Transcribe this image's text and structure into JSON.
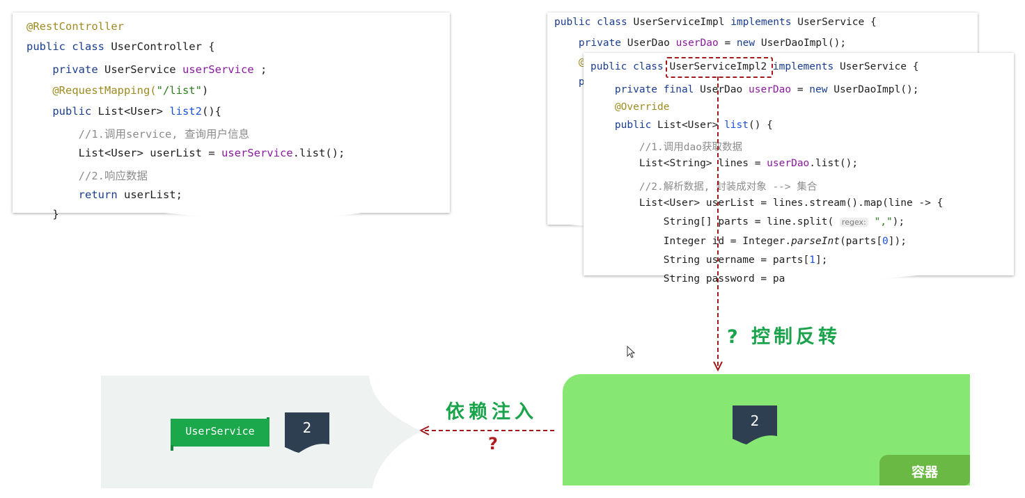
{
  "controller_code": {
    "lines": [
      [
        {
          "t": "@RestController",
          "c": "an"
        }
      ],
      [
        {
          "t": "public class ",
          "c": "kw"
        },
        {
          "t": "UserController {",
          "c": ""
        }
      ],
      [
        {
          "t": "    private ",
          "c": "kw"
        },
        {
          "t": "UserService ",
          "c": ""
        },
        {
          "t": "userService",
          "c": "fld"
        },
        {
          "t": " ;",
          "c": ""
        }
      ],
      [
        {
          "t": "    @RequestMapping(",
          "c": "an"
        },
        {
          "t": "\"/list\"",
          "c": "str"
        },
        {
          "t": ")",
          "c": ""
        }
      ],
      [
        {
          "t": "    public ",
          "c": "kw"
        },
        {
          "t": "List<User> ",
          "c": ""
        },
        {
          "t": "list2",
          "c": "num"
        },
        {
          "t": "(){",
          "c": ""
        }
      ],
      [
        {
          "t": "        //1.调用service, 查询用户信息",
          "c": "cm"
        }
      ],
      [
        {
          "t": "        List<User> userList = ",
          "c": ""
        },
        {
          "t": "userService",
          "c": "fld"
        },
        {
          "t": ".list();",
          "c": ""
        }
      ],
      [
        {
          "t": "        //2.响应数据",
          "c": "cm"
        }
      ],
      [
        {
          "t": "        return ",
          "c": "kw"
        },
        {
          "t": "userList;",
          "c": ""
        }
      ],
      [
        {
          "t": "    }",
          "c": ""
        }
      ]
    ]
  },
  "impl1_code": {
    "lines": [
      [
        {
          "t": "public class ",
          "c": "kw"
        },
        {
          "t": "UserServiceImpl ",
          "c": ""
        },
        {
          "t": "implements ",
          "c": "kw"
        },
        {
          "t": "UserService {",
          "c": ""
        }
      ],
      [
        {
          "t": "    private ",
          "c": "kw"
        },
        {
          "t": "UserDao ",
          "c": ""
        },
        {
          "t": "userDao",
          "c": "fld"
        },
        {
          "t": " = ",
          "c": ""
        },
        {
          "t": "new ",
          "c": "kw"
        },
        {
          "t": "UserDaoImpl();",
          "c": ""
        }
      ],
      [
        {
          "t": "    @",
          "c": "an"
        }
      ],
      [
        {
          "t": "    p",
          "c": "kw"
        }
      ]
    ]
  },
  "impl2_code": {
    "lines": [
      [
        {
          "t": "public class ",
          "c": "kw"
        },
        {
          "t": "UserServiceImpl2 ",
          "c": ""
        },
        {
          "t": "implements ",
          "c": "kw"
        },
        {
          "t": "UserService {",
          "c": ""
        }
      ],
      [
        {
          "t": "    private final ",
          "c": "kw"
        },
        {
          "t": "UserDao ",
          "c": ""
        },
        {
          "t": "userDao",
          "c": "fld"
        },
        {
          "t": " = ",
          "c": ""
        },
        {
          "t": "new ",
          "c": "kw"
        },
        {
          "t": "UserDaoImpl();",
          "c": ""
        }
      ],
      [
        {
          "t": "    @Override",
          "c": "an"
        }
      ],
      [
        {
          "t": "    public ",
          "c": "kw"
        },
        {
          "t": "List<User> ",
          "c": ""
        },
        {
          "t": "list",
          "c": "num"
        },
        {
          "t": "() {",
          "c": ""
        }
      ],
      [
        {
          "t": "        //1.调用dao获取数据",
          "c": "cm"
        }
      ],
      [
        {
          "t": "        List<String> lines = ",
          "c": ""
        },
        {
          "t": "userDao",
          "c": "fld"
        },
        {
          "t": ".list();",
          "c": ""
        }
      ],
      [
        {
          "t": "        //2.解析数据, 封装成对象 --> 集合",
          "c": "cm"
        }
      ],
      [
        {
          "t": "        List<User> userList = lines.stream().map(line -> {",
          "c": ""
        }
      ],
      [
        {
          "t": "            String[] parts = line.split( ",
          "c": ""
        },
        {
          "t": "regex:",
          "c": "hint"
        },
        {
          "t": " \",\"",
          "c": "str"
        },
        {
          "t": ");",
          "c": ""
        }
      ],
      [
        {
          "t": "            Integer id = Integer.",
          "c": ""
        },
        {
          "t": "parseInt",
          "c": "it"
        },
        {
          "t": "(parts[",
          "c": ""
        },
        {
          "t": "0",
          "c": "num"
        },
        {
          "t": "]);",
          "c": ""
        }
      ],
      [
        {
          "t": "            String username = parts[",
          "c": ""
        },
        {
          "t": "1",
          "c": "num"
        },
        {
          "t": "];",
          "c": ""
        }
      ],
      [
        {
          "t": "            String password = pa",
          "c": ""
        }
      ]
    ]
  },
  "labels": {
    "ioc": "? 控制反转",
    "di": "依赖注入",
    "di_question": "?",
    "user_service_tag": "UserService",
    "left_doc_number": "2",
    "right_doc_number": "2",
    "container": "容器"
  },
  "colors": {
    "red": "#a0191b",
    "green_text": "#19a34a",
    "container_green": "#86e873",
    "container_label_bg": "#6bb945",
    "tag_green": "#1aa84a",
    "doc_navy": "#2f3f52",
    "left_panel": "#eef3f2"
  }
}
